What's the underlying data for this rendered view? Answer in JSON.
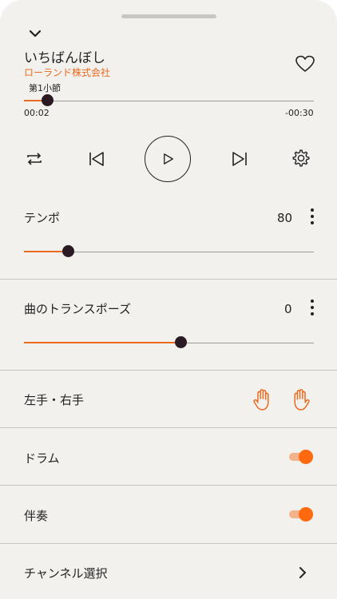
{
  "song": {
    "title": "いちばんぼし",
    "artist": "ローランド株式会社",
    "measure": "第1小節",
    "elapsed": "00:02",
    "remaining": "-00:30",
    "progress": 0.07
  },
  "tempo": {
    "label": "テンポ",
    "value": "80",
    "level": 0.15
  },
  "transpose": {
    "label": "曲のトランスポーズ",
    "value": "0",
    "level": 0.54
  },
  "hands": {
    "label": "左手・右手"
  },
  "drums": {
    "label": "ドラム",
    "on": true
  },
  "accompaniment": {
    "label": "伴奏",
    "on": true
  },
  "channel": {
    "label": "チャンネル選択"
  },
  "colors": {
    "accent": "#ea6a1f",
    "knob": "#2a1a24",
    "background": "#f3f1ed"
  },
  "icons": [
    "chevron-down-icon",
    "heart-icon",
    "repeat-icon",
    "skip-back-icon",
    "play-icon",
    "skip-forward-icon",
    "gear-icon",
    "more-icon",
    "left-hand-icon",
    "right-hand-icon",
    "chevron-right-icon"
  ]
}
